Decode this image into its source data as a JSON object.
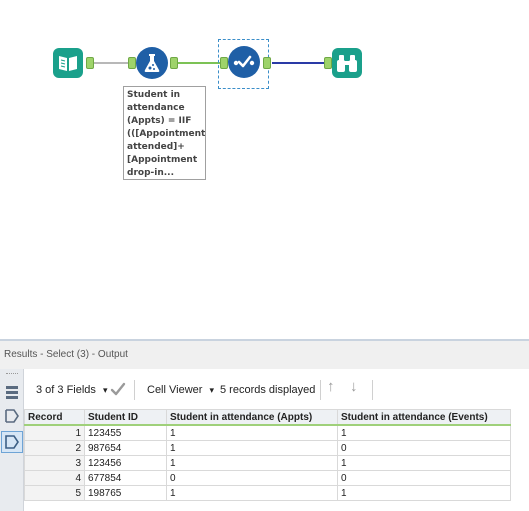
{
  "workflow": {
    "tools": [
      {
        "name": "Input Data",
        "icon": "book-icon",
        "color": "#1aa08b"
      },
      {
        "name": "Formula",
        "icon": "flask-icon",
        "color": "#1f5fa6"
      },
      {
        "name": "Select",
        "icon": "checkmark-path-icon",
        "color": "#1f5fa6"
      },
      {
        "name": "Browse",
        "icon": "binoculars-icon",
        "color": "#1aa08b"
      }
    ],
    "formula_annotation": "Student in\nattendance\n(Appts) = IIF\n(([Appointment\nattended]+\n[Appointment\ndrop-in..."
  },
  "results": {
    "header_title": "Results - Select (3) - Output",
    "toolbar": {
      "fields_label": "3 of 3 Fields",
      "dropdown_arrow": "▾",
      "viewer_label": "Cell Viewer",
      "records_label": "5 records displayed",
      "up_arrow": "↑",
      "down_arrow": "↓"
    },
    "columns": [
      "Record",
      "Student ID",
      "Student in attendance (Appts)",
      "Student in attendance (Events)"
    ],
    "rows": [
      [
        "1",
        "123455",
        "1",
        "1"
      ],
      [
        "2",
        "987654",
        "1",
        "0"
      ],
      [
        "3",
        "123456",
        "1",
        "1"
      ],
      [
        "4",
        "677854",
        "0",
        "0"
      ],
      [
        "5",
        "198765",
        "1",
        "1"
      ]
    ]
  },
  "colors": {
    "connection_green": "#7cc255",
    "connection_blue": "#2a3aa6",
    "header_accent": "#9fd07a"
  }
}
